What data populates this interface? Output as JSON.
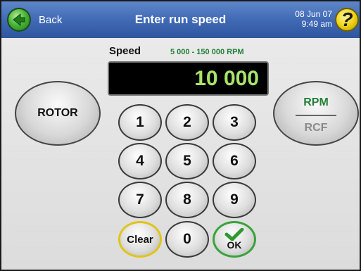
{
  "header": {
    "back_label": "Back",
    "title": "Enter run speed",
    "date": "08 Jun 07",
    "time": "9:49 am",
    "help_symbol": "?"
  },
  "speed": {
    "label": "Speed",
    "range": "5 000 - 150 000 RPM",
    "value": "10 000"
  },
  "buttons": {
    "rotor": "ROTOR",
    "rpm": "RPM",
    "rcf": "RCF"
  },
  "keypad": {
    "k1": "1",
    "k2": "2",
    "k3": "3",
    "k4": "4",
    "k5": "5",
    "k6": "6",
    "k7": "7",
    "k8": "8",
    "k9": "9",
    "clear": "Clear",
    "k0": "0",
    "ok": "OK"
  },
  "colors": {
    "header_blue": "#3f68b4",
    "display_green": "#a8e36a",
    "active_unit_green": "#23803a",
    "clear_border_yellow": "#e0c419",
    "ok_border_green": "#3aa33c"
  },
  "icons": {
    "back": "back-arrow-icon",
    "help": "help-question-icon",
    "ok": "checkmark-icon"
  }
}
